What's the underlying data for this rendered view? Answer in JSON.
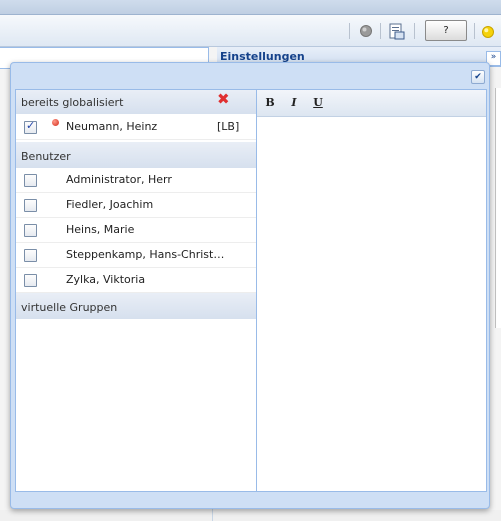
{
  "toolbar": {
    "help_label": "?"
  },
  "background_panel": {
    "title": "Einstellungen"
  },
  "left_panel": {
    "globalized": {
      "header": "bereits globalisiert",
      "items": [
        {
          "name": "Neumann, Heinz",
          "tag": "[LB]",
          "checked": true
        }
      ]
    },
    "users": {
      "header": "Benutzer",
      "items": [
        {
          "name": "Administrator, Herr",
          "checked": false
        },
        {
          "name": "Fiedler, Joachim",
          "checked": false
        },
        {
          "name": "Heins, Marie",
          "checked": false
        },
        {
          "name": "Steppenkamp, Hans-Christ…",
          "checked": false
        },
        {
          "name": "Zylka, Viktoria",
          "checked": false
        }
      ]
    },
    "virtual_groups": {
      "header": "virtuelle Gruppen"
    }
  },
  "editor": {
    "bold_label": "B",
    "italic_label": "I",
    "underline_label": "U",
    "content": ""
  },
  "colors": {
    "panel_border": "#99bbe8",
    "title_blue": "#15428b",
    "delete_red": "#e03030",
    "status_dot": "#d22a1a"
  }
}
